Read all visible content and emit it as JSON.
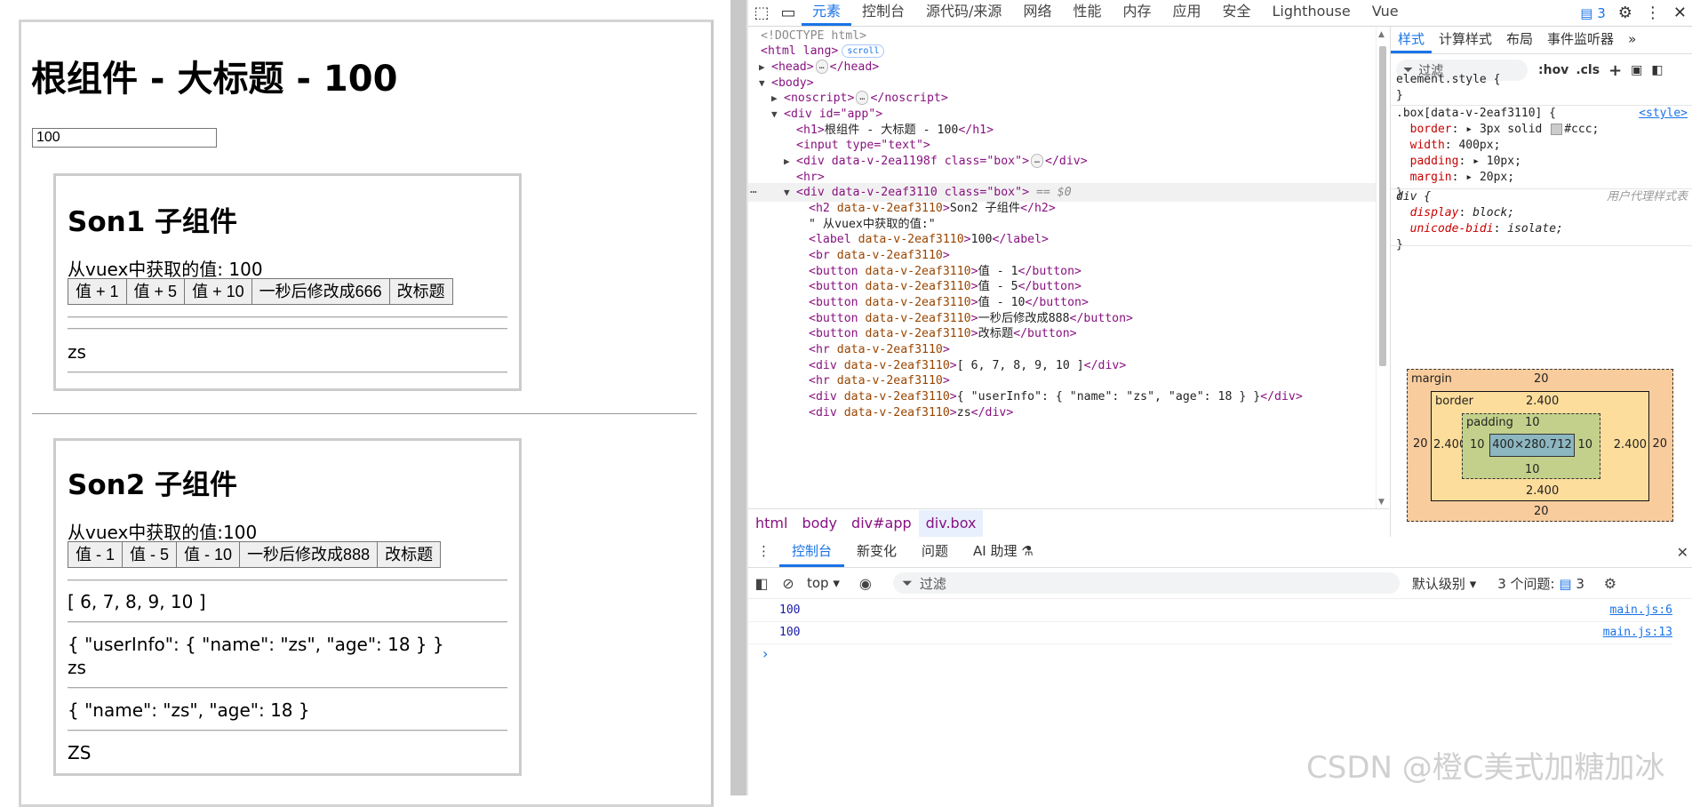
{
  "app": {
    "root_title": "根组件 - 大标题 - 100",
    "input_value": "100",
    "son1": {
      "title": "Son1 子组件",
      "value_text": "从vuex中获取的值: 100",
      "buttons": [
        "值 + 1",
        "值 + 5",
        "值 + 10",
        "一秒后修改成666",
        "改标题"
      ],
      "name_text": "zs"
    },
    "son2": {
      "title": "Son2 子组件",
      "value_text": "从vuex中获取的值:100",
      "buttons": [
        "值 - 1",
        "值 - 5",
        "值 - 10",
        "一秒后修改成888",
        "改标题"
      ],
      "list_text": "[ 6, 7, 8, 9, 10 ]",
      "userinfo_text": "{ \"userInfo\": { \"name\": \"zs\", \"age\": 18 } }",
      "name_text": "zs",
      "obj_text": "{ \"name\": \"zs\", \"age\": 18 }",
      "upper_text": "ZS"
    }
  },
  "devtools": {
    "tabs": [
      "元素",
      "控制台",
      "源代码/来源",
      "网络",
      "性能",
      "内存",
      "应用",
      "安全",
      "Lighthouse",
      "Vue"
    ],
    "active_tab": "元素",
    "issues_badge": "3",
    "elements": {
      "doctype": "<!DOCTYPE html>",
      "html_open": "<html lang>",
      "scroll_pill": "scroll",
      "head": "<head>",
      "head_close": "</head>",
      "body": "<body>",
      "noscript": "<noscript>",
      "noscript_close": "</noscript>",
      "div_app": "<div id=\"app\">",
      "h1_line": "根组件 - 大标题 - 100",
      "input_line": "<input type=\"text\">",
      "div_box1": "<div data-v-2ea1198f class=\"box\">",
      "div_close": "</div>",
      "hr": "<hr>",
      "div_box2": "<div data-v-2eaf3110 class=\"box\">",
      "selected_marker": "== $0",
      "h2_line": "Son2 子组件",
      "text_node": "\" 从vuex中获取的值:\"",
      "label_value": "100",
      "btn1": "值 - 1",
      "btn2": "值 - 5",
      "btn3": "值 - 10",
      "btn4": "一秒后修改成888",
      "btn5": "改标题",
      "div_list": "[ 6, 7, 8, 9, 10 ]",
      "div_userinfo": "{ \"userInfo\": { \"name\": \"zs\", \"age\": 18 } }",
      "div_zs": "zs"
    },
    "breadcrumb": [
      "html",
      "body",
      "div#app",
      "div.box"
    ],
    "styles": {
      "tabs": [
        "样式",
        "计算样式",
        "布局",
        "事件监听器"
      ],
      "filter_placeholder": "过滤",
      "hov": ":hov",
      "cls": ".cls",
      "element_style": "element.style {",
      "rule_selector": ".box[data-v-2eaf3110] {",
      "rule_source": "<style>",
      "border": "3px solid",
      "border_color": "#ccc;",
      "width": "400px;",
      "padding": "10px;",
      "margin": "20px;",
      "ua_selector": "div {",
      "ua_label": "用户代理样式表",
      "display": "block;",
      "unicode_bidi": "isolate;"
    },
    "box_model": {
      "margin_label": "margin",
      "margin": "20",
      "border_label": "border",
      "border": "2.400",
      "padding_label": "padding",
      "padding": "10",
      "content": "400×280.712"
    },
    "drawer_tabs": [
      "控制台",
      "新变化",
      "问题",
      "AI 助理"
    ],
    "console": {
      "context": "top",
      "filter_placeholder": "过滤",
      "levels": "默认级别",
      "issues": "3 个问题:",
      "issues_count": "3",
      "logs": [
        {
          "value": "100",
          "source": "main.js:6"
        },
        {
          "value": "100",
          "source": "main.js:13"
        }
      ]
    }
  },
  "watermark": "CSDN @橙C美式加糖加冰"
}
